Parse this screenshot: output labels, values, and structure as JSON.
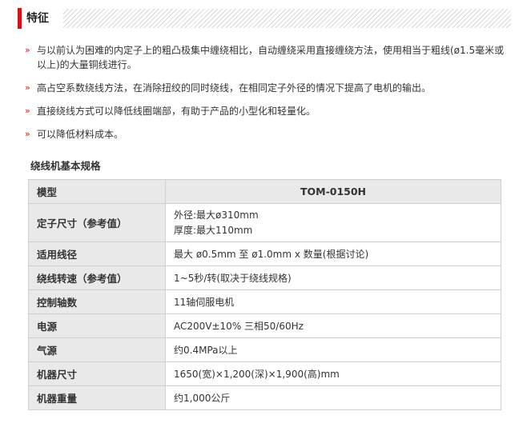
{
  "feature": {
    "title": "特征"
  },
  "bullets": [
    "与以前认为困难的内定子上的粗凸极集中缠绕相比，自动缠绕采用直接缠绕方法，使用相当于粗线(ø1.5毫米或以上)的大量铜线进行。",
    "高占空系数绕线方法，在消除扭绞的同时绕线，在相同定子外径的情况下提高了电机的输出。",
    "直接绕线方式可以降低线圈端部，有助于产品的小型化和轻量化。",
    "可以降低材料成本。"
  ],
  "bullet_icon": "»",
  "spec": {
    "title": "绕线机基本规格",
    "header": {
      "key": "模型",
      "value": "TOM-0150H"
    },
    "rows": [
      {
        "key": "定子尺寸（参考值）",
        "lines": [
          "外径:最大ø310mm",
          "厚度:最大110mm"
        ]
      },
      {
        "key": "适用线径",
        "lines": [
          "最大 ø0.5mm 至 ø1.0mm x 数量(根据讨论)"
        ]
      },
      {
        "key": "绕线转速（参考值）",
        "lines": [
          "1~5秒/转(取决于绕线规格)"
        ]
      },
      {
        "key": "控制轴数",
        "lines": [
          "11轴伺服电机"
        ]
      },
      {
        "key": "电源",
        "lines": [
          "AC200V±10% 三相50/60Hz"
        ]
      },
      {
        "key": "气源",
        "lines": [
          "约0.4MPa以上"
        ]
      },
      {
        "key": "机器尺寸",
        "lines": [
          "1650(宽)×1,200(深)×1,900(高)mm"
        ]
      },
      {
        "key": "机器重量",
        "lines": [
          "约1,000公斤"
        ]
      }
    ]
  },
  "colors": {
    "accent": "#c8161d",
    "header_bg": "#e9e9e9",
    "border": "#cfcfcf"
  }
}
